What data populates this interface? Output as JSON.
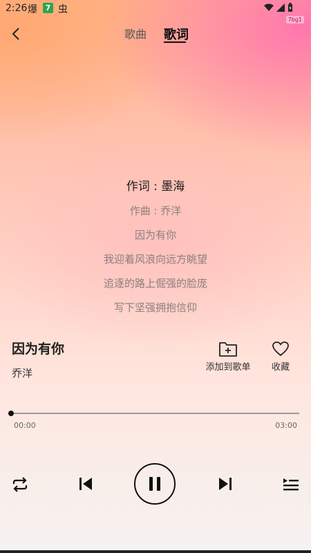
{
  "status_bar": {
    "time": "2:26",
    "notif_1": "爆",
    "notif_2": "7",
    "notif_3": "虫",
    "tag": "7bg1"
  },
  "header": {
    "tabs": [
      {
        "label": "歌曲"
      },
      {
        "label": "歌词",
        "active": true
      }
    ]
  },
  "lyrics": [
    {
      "text": "作词 : 墨海",
      "active": true
    },
    {
      "text": "作曲 : 乔洋"
    },
    {
      "text": "因为有你"
    },
    {
      "text": "我迎着风浪向远方眺望"
    },
    {
      "text": "追逐的路上倔强的脸庞"
    },
    {
      "text": "写下坚强拥抱信仰"
    }
  ],
  "song": {
    "title": "因为有你",
    "artist": "乔洋"
  },
  "actions": {
    "add_to_playlist": {
      "label": "添加到歌单",
      "icon": "folder-add-icon"
    },
    "favorite": {
      "label": "收藏",
      "icon": "heart-icon"
    }
  },
  "progress": {
    "current": "00:00",
    "total": "03:00",
    "fraction": 0.0
  },
  "controls": {
    "repeat": "repeat-icon",
    "previous": "skip-previous-icon",
    "play_pause": "pause-icon",
    "next": "skip-next-icon",
    "playlist": "playlist-icon"
  },
  "colors": {
    "accent": "#111111",
    "lyric_inactive": "#8b7f7c"
  }
}
